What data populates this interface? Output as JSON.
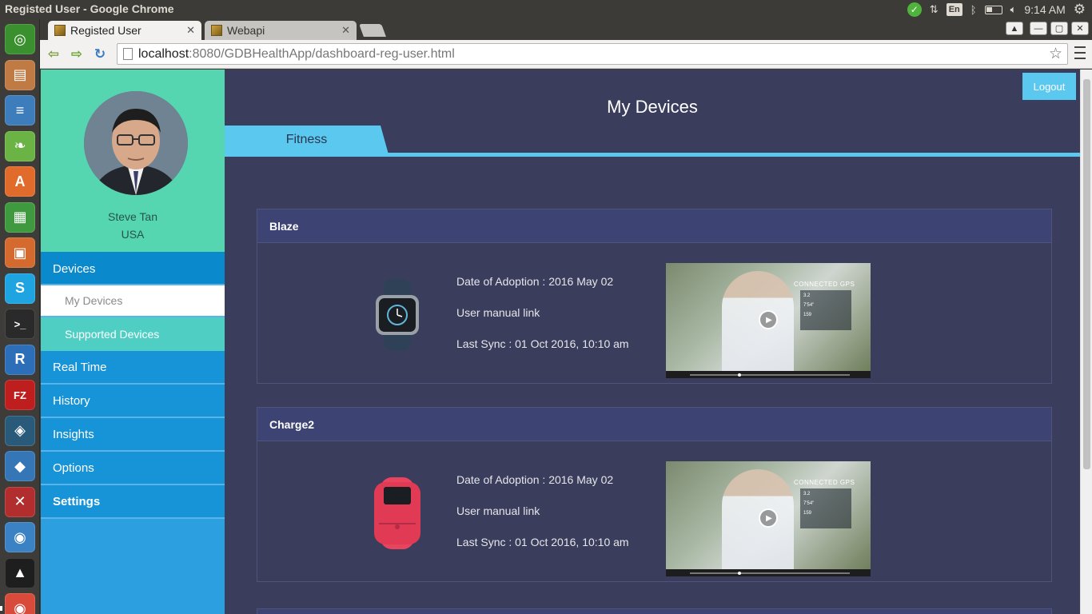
{
  "os": {
    "window_title": "Registed User - Google Chrome",
    "language_indicator": "En",
    "clock": "9:14 AM",
    "icons": [
      "check-icon",
      "network-arrows-icon",
      "language-icon",
      "bluetooth-icon",
      "battery-icon",
      "volume-icon",
      "gear-icon"
    ]
  },
  "launcher": {
    "items": [
      {
        "name": "ubuntu-dash-icon",
        "color": "#3a8f2e",
        "glyph": "◎"
      },
      {
        "name": "files-icon",
        "color": "#c07a43",
        "glyph": "▤"
      },
      {
        "name": "writer-icon",
        "color": "#3d7dbb",
        "glyph": "≡"
      },
      {
        "name": "spring-icon",
        "color": "#6ab344",
        "glyph": "❧"
      },
      {
        "name": "software-center-icon",
        "color": "#e06b2a",
        "glyph": "A"
      },
      {
        "name": "calc-icon",
        "color": "#3f9a3f",
        "glyph": "▦"
      },
      {
        "name": "impress-icon",
        "color": "#d56a2e",
        "glyph": "▣"
      },
      {
        "name": "skype-icon",
        "color": "#1ea4e0",
        "glyph": "S"
      },
      {
        "name": "terminal-icon",
        "color": "#2a2a2a",
        "glyph": ">_"
      },
      {
        "name": "r-icon",
        "color": "#2c6fb8",
        "glyph": "R"
      },
      {
        "name": "filezilla-icon",
        "color": "#bf1e1e",
        "glyph": "FZ"
      },
      {
        "name": "mysql-workbench-icon",
        "color": "#2a5a7a",
        "glyph": "◈"
      },
      {
        "name": "virtualbox-icon",
        "color": "#3576b6",
        "glyph": "◆"
      },
      {
        "name": "app-red-icon",
        "color": "#b22d2d",
        "glyph": "✕"
      },
      {
        "name": "chromium-icon",
        "color": "#3b82c4",
        "glyph": "◉"
      },
      {
        "name": "inkscape-icon",
        "color": "#1e1e1e",
        "glyph": "▲"
      },
      {
        "name": "chrome-icon",
        "color": "#d84a3a",
        "glyph": "◉"
      }
    ]
  },
  "browser": {
    "tabs": [
      {
        "title": "Registed User",
        "active": true
      },
      {
        "title": "Webapi",
        "active": false
      }
    ],
    "url_host": "localhost",
    "url_rest": ":8080/GDBHealthApp/dashboard-reg-user.html"
  },
  "sidebar": {
    "user_name": "Steve Tan",
    "user_country": "USA",
    "menu": {
      "devices": "Devices",
      "my_devices": "My Devices",
      "supported_devices": "Supported Devices",
      "real_time": "Real Time",
      "history": "History",
      "insights": "Insights",
      "options": "Options",
      "settings": "Settings"
    }
  },
  "main": {
    "logout": "Logout",
    "title": "My Devices",
    "tab": "Fitness",
    "devices": [
      {
        "name": "Blaze",
        "adoption": "Date of Adoption : 2016 May 02",
        "manual": "User manual link",
        "sync": "Last Sync : 01 Oct 2016, 10:10 am",
        "band_color": "#2f4157",
        "face_color": "#1a1d22"
      },
      {
        "name": "Charge2",
        "adoption": "Date of Adoption : 2016 May 02",
        "manual": "User manual link",
        "sync": "Last Sync : 01 Oct 2016, 10:10 am",
        "band_color": "#e8445f",
        "face_color": "#1a1d22"
      }
    ],
    "video_brand": "CONNECTED GPS",
    "video_stats": [
      "3.2",
      "7'54\"",
      "159"
    ]
  }
}
